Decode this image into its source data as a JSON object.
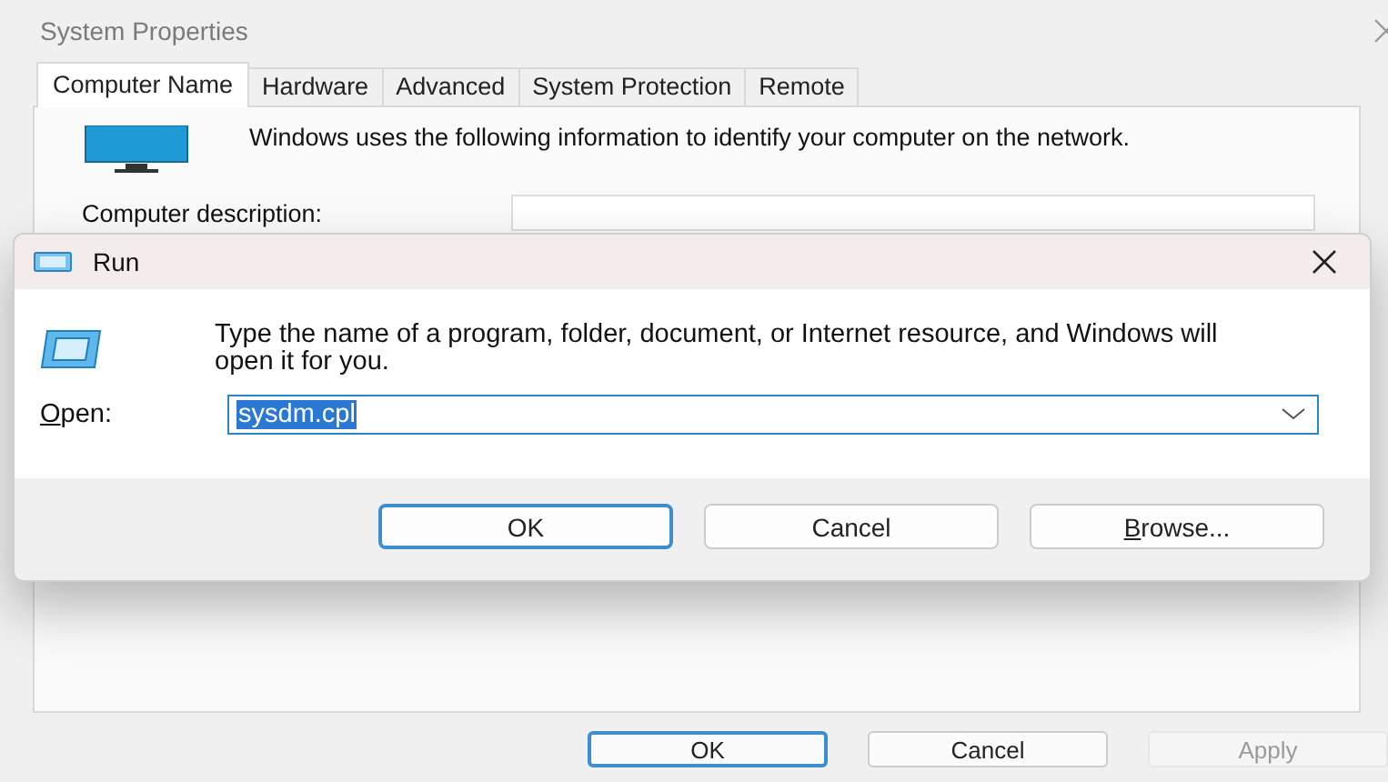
{
  "window": {
    "title": "System Properties"
  },
  "tabs": [
    {
      "label": "Computer Name",
      "selected": true
    },
    {
      "label": "Hardware",
      "selected": false
    },
    {
      "label": "Advanced",
      "selected": false
    },
    {
      "label": "System Protection",
      "selected": false
    },
    {
      "label": "Remote",
      "selected": false
    }
  ],
  "panel": {
    "intro": "Windows uses the following information to identify your computer on the network.",
    "description_label": "Computer description:"
  },
  "buttons": [
    {
      "label": "OK",
      "default": true,
      "disabled": false
    },
    {
      "label": "Cancel",
      "default": false,
      "disabled": false
    },
    {
      "label": "Apply",
      "default": false,
      "disabled": true
    }
  ],
  "run_dialog": {
    "title": "Run",
    "message": "Type the name of a program, folder, document, or Internet resource, and Windows will open it for you.",
    "open_label": {
      "mnemonic": "O",
      "rest": "pen:"
    },
    "open_value": "sysdm.cpl",
    "value_selected": true,
    "buttons": [
      {
        "rest": "OK",
        "default": true
      },
      {
        "rest": "Cancel",
        "default": false
      },
      {
        "mnemonic": "B",
        "rest": "rowse...",
        "default": false
      }
    ]
  }
}
